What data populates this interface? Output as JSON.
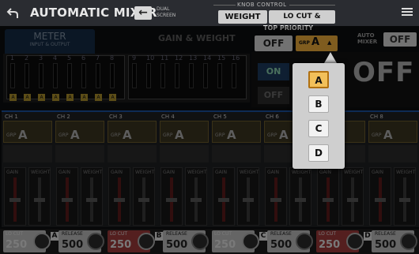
{
  "header": {
    "title": "AUTOMATIC MIXER",
    "dual_screen": [
      "DUAL",
      "SCREEN"
    ],
    "knob_control": "KNOB CONTROL",
    "weight": "WEIGHT",
    "lo_cut_release": "LO CUT & RELEASE"
  },
  "tabs": {
    "meter": "METER",
    "meter_sub": "INPUT & OUTPUT",
    "gain_weight": "GAIN & WEIGHT"
  },
  "top_priority": {
    "label": "TOP PRIORITY",
    "off": "OFF",
    "grp_prefix": "GRP",
    "grp_value": "A"
  },
  "auto_mixer": {
    "label": [
      "AUTO",
      "MIXER"
    ],
    "value": "OFF"
  },
  "meter_channels": [
    "1",
    "2",
    "3",
    "4",
    "5",
    "6",
    "7",
    "8",
    "9",
    "10",
    "11",
    "12",
    "13",
    "14",
    "15",
    "16"
  ],
  "meter_group_letter": "A",
  "group_area": {
    "on_label": "ON",
    "off_label": "OFF",
    "big_off": "OFF"
  },
  "channels": [
    {
      "name": "CH 1",
      "group": "A"
    },
    {
      "name": "CH 2",
      "group": "A"
    },
    {
      "name": "CH 3",
      "group": "A"
    },
    {
      "name": "CH 4",
      "group": "A"
    },
    {
      "name": "CH 5",
      "group": "A"
    },
    {
      "name": "CH 6",
      "group": "A"
    },
    {
      "name": "CH 7",
      "group": "A"
    },
    {
      "name": "CH 8",
      "group": "A"
    }
  ],
  "channel_labels": {
    "grp": "GRP",
    "gain": "GAIN",
    "weight": "WEIGHT"
  },
  "bottom_groups": [
    {
      "lo_cut_label": "LO CUT",
      "lo_cut_value": "250",
      "group": "A",
      "release_label": "RELEASE",
      "release_value": "500",
      "color": "#b8b8b8"
    },
    {
      "lo_cut_label": "LO CUT",
      "lo_cut_value": "250",
      "group": "B",
      "release_label": "RELEASE",
      "release_value": "500",
      "color": "#9a3a3a"
    },
    {
      "lo_cut_label": "LO CUT",
      "lo_cut_value": "250",
      "group": "C",
      "release_label": "RELEASE",
      "release_value": "500",
      "color": "#b8b8b8"
    },
    {
      "lo_cut_label": "LO CUT",
      "lo_cut_value": "250",
      "group": "D",
      "release_label": "RELEASE",
      "release_value": "500",
      "color": "#9a3a3a"
    }
  ],
  "popup": {
    "options": [
      "A",
      "B",
      "C",
      "D"
    ],
    "selected": "A"
  }
}
